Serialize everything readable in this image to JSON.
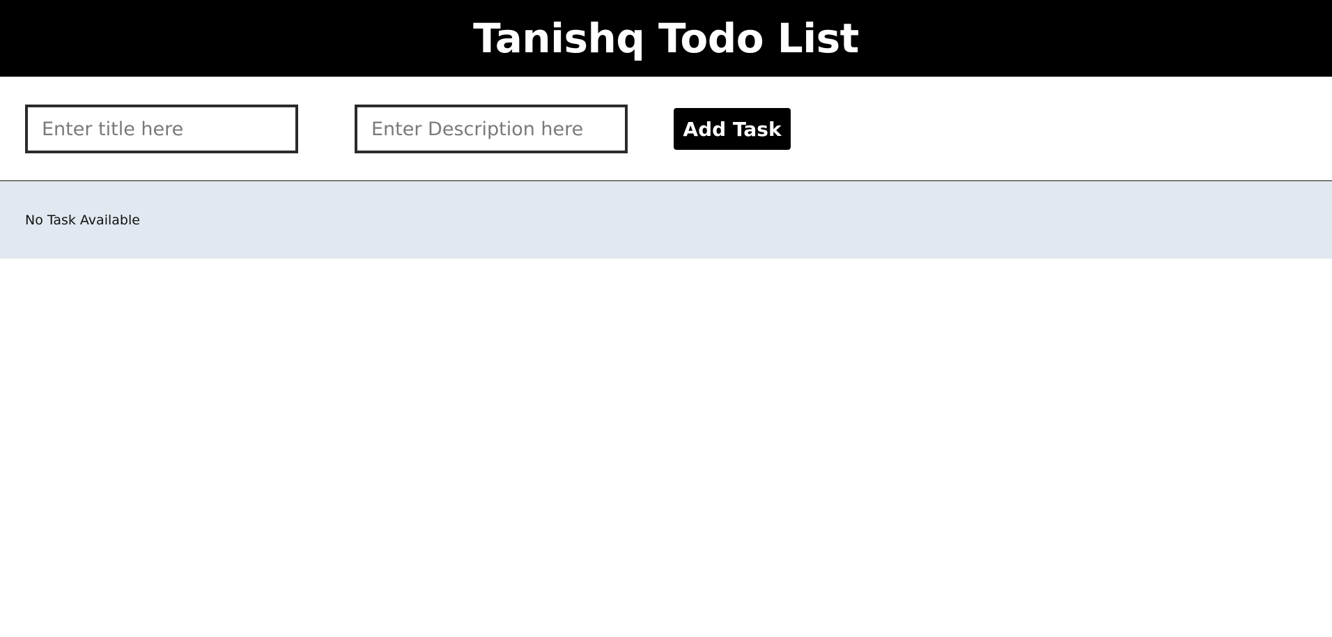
{
  "header": {
    "title": "Tanishq Todo List"
  },
  "form": {
    "title_placeholder": "Enter title here",
    "title_value": "",
    "description_placeholder": "Enter Description here",
    "description_value": "",
    "add_button_label": "Add Task"
  },
  "tasks": {
    "items": [],
    "empty_message": "No Task Available"
  },
  "colors": {
    "header_bg": "#000000",
    "header_text": "#ffffff",
    "button_bg": "#000000",
    "button_text": "#ffffff",
    "task_area_bg": "#e1e8f0"
  }
}
